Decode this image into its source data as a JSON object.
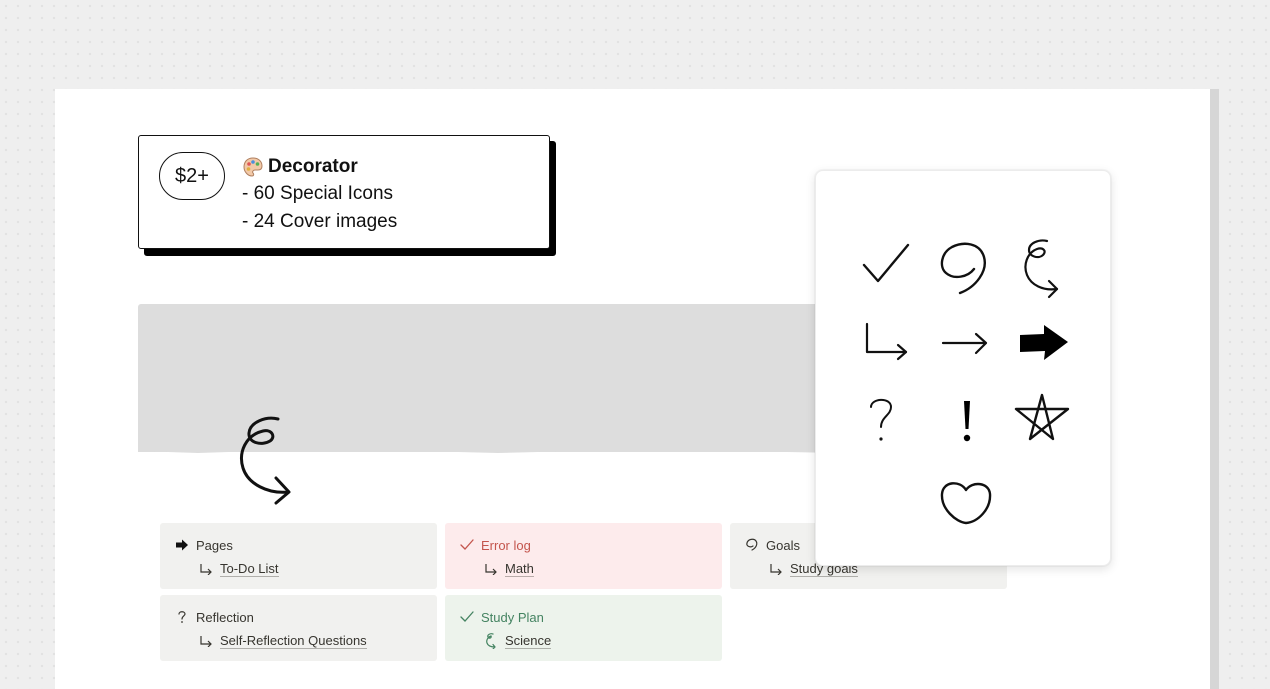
{
  "price_card": {
    "price": "$2+",
    "title": "Decorator",
    "lines": [
      "- 60 Special Icons",
      "- 24 Cover images"
    ]
  },
  "page_icon": "spiral-arrow-icon",
  "tiles": [
    {
      "title": "Pages",
      "title_icon": "arrow-right-filled-icon",
      "link": "To-Do List",
      "link_icon": "return-arrow-icon",
      "color": "gray"
    },
    {
      "title": "Error log",
      "title_icon": "check-icon",
      "link": "Math",
      "link_icon": "return-arrow-icon",
      "color": "red"
    },
    {
      "title": "Goals",
      "title_icon": "loop-icon",
      "link": "Study goals",
      "link_icon": "return-arrow-icon",
      "color": "gray"
    },
    {
      "title": "Reflection",
      "title_icon": "question-icon",
      "link": "Self-Reflection Questions",
      "link_icon": "return-arrow-icon",
      "color": "gray"
    },
    {
      "title": "Study Plan",
      "title_icon": "check-icon",
      "link": "Science",
      "link_icon": "spiral-arrow-icon",
      "color": "green"
    }
  ],
  "icon_picker": {
    "icons": [
      "check-icon",
      "loop-icon",
      "spiral-arrow-icon",
      "return-arrow-icon",
      "arrow-right-icon",
      "arrow-right-filled-icon",
      "question-icon",
      "exclamation-icon",
      "star-icon",
      "heart-icon"
    ]
  },
  "colors": {
    "tile_gray": "#f1f1ef",
    "tile_red": "#fdebec",
    "tile_green": "#edf3ec",
    "red_text": "#c4554d",
    "green_text": "#448361",
    "cover": "#dddddd"
  }
}
